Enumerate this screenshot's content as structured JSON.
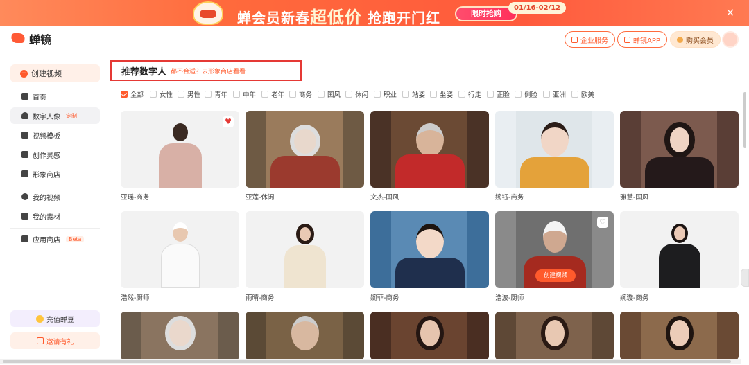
{
  "banner": {
    "promo_prefix": "蝉会员新春",
    "promo_big": "超低价",
    "promo_suffix": " 抢跑开门红",
    "cta": "限时抢购",
    "date_range": "01/16-02/12",
    "close": "×"
  },
  "header": {
    "logo_text": "蝉镜",
    "enterprise": "企业服务",
    "app": "蝉镜APP",
    "buy_vip": "购买会员"
  },
  "sidebar": {
    "create": "创建视频",
    "items": [
      {
        "label": "首页"
      },
      {
        "label": "数字人像",
        "tag": "定制"
      },
      {
        "label": "视频模板"
      },
      {
        "label": "创作灵感"
      },
      {
        "label": "形象商店"
      },
      {
        "label": "我的视频"
      },
      {
        "label": "我的素材"
      },
      {
        "label": "应用商店",
        "tag": "Beta"
      }
    ],
    "recharge": "充值蝉豆",
    "invite": "邀请有礼"
  },
  "main": {
    "title": "推荐数字人",
    "subtitle": "都不合适？去形象商店看看",
    "filters": [
      "全部",
      "女性",
      "男性",
      "青年",
      "中年",
      "老年",
      "商务",
      "国风",
      "休闲",
      "职业",
      "站姿",
      "坐姿",
      "行走",
      "正脸",
      "侧脸",
      "亚洲",
      "欧美"
    ],
    "cards": [
      {
        "label": "亚瑶-商务"
      },
      {
        "label": "亚莲-休闲"
      },
      {
        "label": "文杰-国风"
      },
      {
        "label": "婉钰-商务"
      },
      {
        "label": "雅慧-国风"
      },
      {
        "label": "浩然-厨师"
      },
      {
        "label": "雨晴-商务"
      },
      {
        "label": "婉菲-商务"
      },
      {
        "label": "浩波-厨师",
        "overlay": "创建视频"
      },
      {
        "label": "婉璇-商务"
      }
    ]
  },
  "colors": {
    "accent": "#ff5a2c",
    "highlight_box": "#e53935"
  }
}
